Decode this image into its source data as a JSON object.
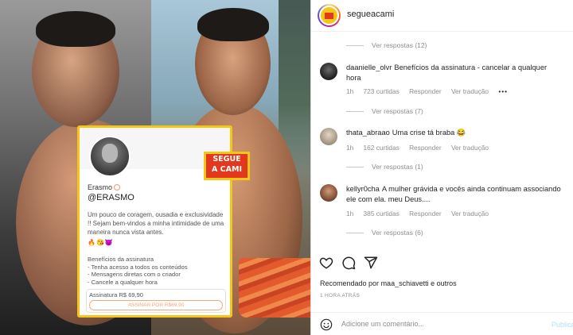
{
  "post": {
    "account": "segueacami",
    "sticker": {
      "line1": "SEGUE",
      "line2": "A CAMI"
    },
    "card": {
      "name": "Erasmo",
      "handle": "@ERASMO",
      "bio": "Um pouco de coragem, ousadia e exclusividade !! Sejam bem-vindos a minha intimidade de uma maneira nunca vista antes.",
      "emoji": "🔥😘😈",
      "benefits_title": "Benefícios da assinatura",
      "benefit_1": "- Tenha acesso a todos os conteúdos",
      "benefit_2": "- Mensagens diretas com o criador",
      "benefit_3": "- Cancele a qualquer hora",
      "price_label": "Assinatura R$ 69,90",
      "subscribe_button": "ASSINAR POR R$69,90"
    }
  },
  "comments": [
    {
      "view_replies_before": "Ver respostas (12)",
      "user": "daanielle_olvr",
      "text": "Benefícios da assinatura - cancelar a qualquer hora",
      "time": "1h",
      "likes": "723 curtidas",
      "reply": "Responder",
      "translate": "Ver tradução",
      "more": "•••",
      "view_replies_after": "Ver respostas (7)",
      "avatar_color": "#2b2b2b"
    },
    {
      "user": "thata_abraao",
      "text": "Uma crise tá braba 😂",
      "time": "1h",
      "likes": "162 curtidas",
      "reply": "Responder",
      "translate": "Ver tradução",
      "view_replies_after": "Ver respostas (1)",
      "avatar_color": "#c9b8a6"
    },
    {
      "user": "kellyr0cha",
      "text": "A mulher grávida e vocês ainda continuam associando ele com ela. meu Deus....",
      "time": "1h",
      "likes": "385 curtidas",
      "reply": "Responder",
      "translate": "Ver tradução",
      "view_replies_after": "Ver respostas (6)",
      "avatar_color": "#a0674a"
    }
  ],
  "actions": {
    "icons": [
      "heart-icon",
      "comment-icon",
      "share-icon",
      "bookmark-icon"
    ]
  },
  "liked_by": {
    "prefix": "Recomendado por ",
    "user": "maa_schiavetti",
    "suffix": " e outros"
  },
  "timestamp": "1 HORA ATRÁS",
  "add_comment": {
    "placeholder": "Adicione um comentário...",
    "publish": "Publicar"
  },
  "colors": {
    "sticker_red": "#e3371e",
    "sticker_yellow": "#f5c518",
    "link_blue": "#b2dffc"
  }
}
